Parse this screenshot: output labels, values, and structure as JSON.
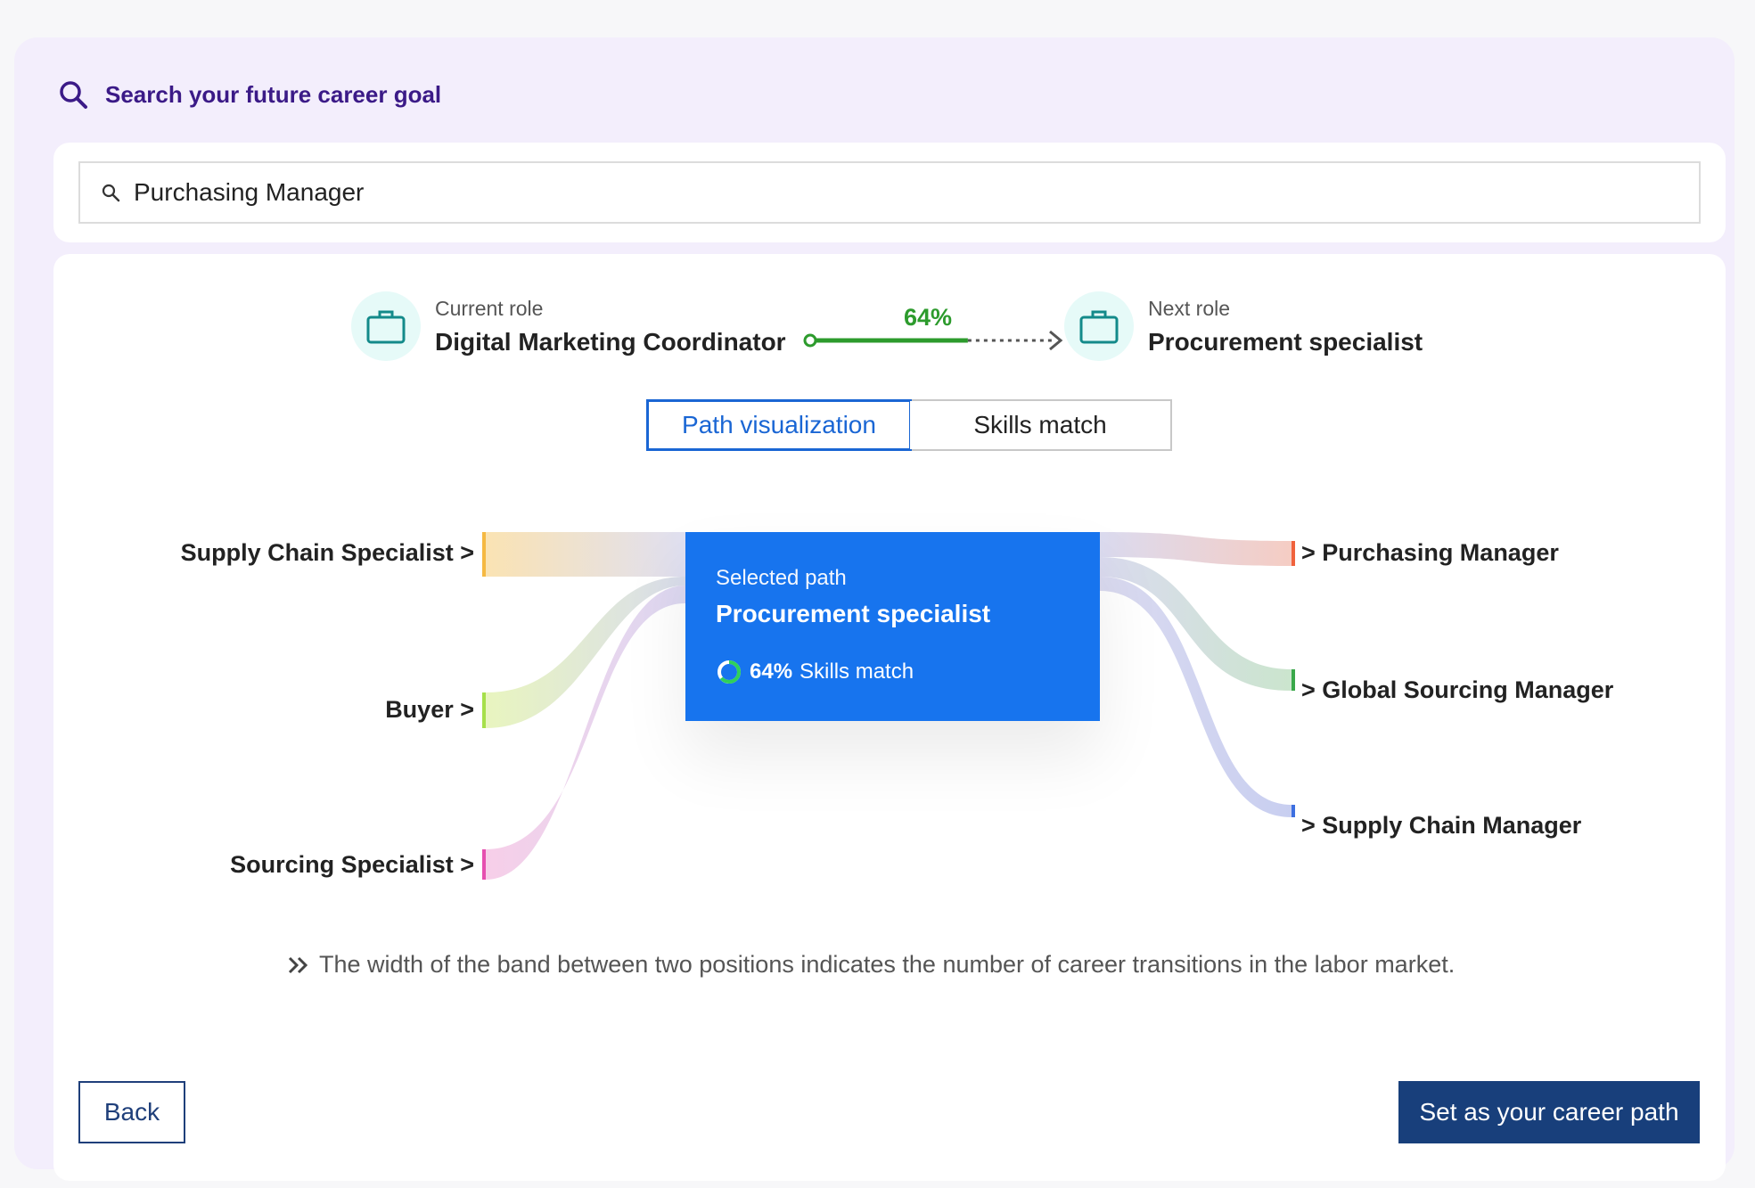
{
  "header": {
    "title": "Search your future career goal",
    "icon": "search-icon"
  },
  "search": {
    "value": "Purchasing Manager",
    "icon": "search-icon"
  },
  "current_role": {
    "label": "Current role",
    "name": "Digital Marketing Coordinator",
    "icon": "briefcase-icon"
  },
  "transition": {
    "percent": "64%",
    "fill_fraction": 0.64
  },
  "next_role": {
    "label": "Next role",
    "name": "Procurement specialist",
    "icon": "briefcase-icon"
  },
  "tabs": [
    {
      "label": "Path visualization",
      "active": true
    },
    {
      "label": "Skills match",
      "active": false
    }
  ],
  "sources": [
    {
      "label": "Supply Chain Specialist >",
      "color": "#f5b942"
    },
    {
      "label": "Buyer >",
      "color": "#a6e04a"
    },
    {
      "label": "Sourcing Specialist >",
      "color": "#e64fb0"
    }
  ],
  "selected": {
    "caption": "Selected path",
    "title": "Procurement specialist",
    "match_percent": "64%",
    "match_label": "Skills match"
  },
  "destinations": [
    {
      "label": "> Purchasing Manager",
      "color": "#f0623c"
    },
    {
      "label": "> Global Sourcing Manager",
      "color": "#3aa84a"
    },
    {
      "label": "> Supply Chain Manager",
      "color": "#3d6fe0"
    }
  ],
  "note": "The width of the band between two positions indicates the number of career transitions in the labor market.",
  "actions": {
    "back": "Back",
    "set_path": "Set as your career path"
  },
  "colors": {
    "accent_blue": "#1774ee",
    "primary_navy": "#183f7b",
    "brand_purple": "#3b1a87",
    "progress_green": "#2d9b2d"
  }
}
